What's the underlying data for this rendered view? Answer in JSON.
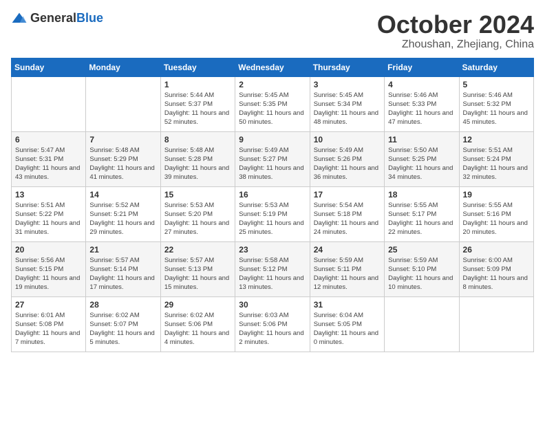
{
  "header": {
    "logo_general": "General",
    "logo_blue": "Blue",
    "month": "October 2024",
    "location": "Zhoushan, Zhejiang, China"
  },
  "weekdays": [
    "Sunday",
    "Monday",
    "Tuesday",
    "Wednesday",
    "Thursday",
    "Friday",
    "Saturday"
  ],
  "weeks": [
    [
      {
        "day": "",
        "info": ""
      },
      {
        "day": "",
        "info": ""
      },
      {
        "day": "1",
        "info": "Sunrise: 5:44 AM\nSunset: 5:37 PM\nDaylight: 11 hours and 52 minutes."
      },
      {
        "day": "2",
        "info": "Sunrise: 5:45 AM\nSunset: 5:35 PM\nDaylight: 11 hours and 50 minutes."
      },
      {
        "day": "3",
        "info": "Sunrise: 5:45 AM\nSunset: 5:34 PM\nDaylight: 11 hours and 48 minutes."
      },
      {
        "day": "4",
        "info": "Sunrise: 5:46 AM\nSunset: 5:33 PM\nDaylight: 11 hours and 47 minutes."
      },
      {
        "day": "5",
        "info": "Sunrise: 5:46 AM\nSunset: 5:32 PM\nDaylight: 11 hours and 45 minutes."
      }
    ],
    [
      {
        "day": "6",
        "info": "Sunrise: 5:47 AM\nSunset: 5:31 PM\nDaylight: 11 hours and 43 minutes."
      },
      {
        "day": "7",
        "info": "Sunrise: 5:48 AM\nSunset: 5:29 PM\nDaylight: 11 hours and 41 minutes."
      },
      {
        "day": "8",
        "info": "Sunrise: 5:48 AM\nSunset: 5:28 PM\nDaylight: 11 hours and 39 minutes."
      },
      {
        "day": "9",
        "info": "Sunrise: 5:49 AM\nSunset: 5:27 PM\nDaylight: 11 hours and 38 minutes."
      },
      {
        "day": "10",
        "info": "Sunrise: 5:49 AM\nSunset: 5:26 PM\nDaylight: 11 hours and 36 minutes."
      },
      {
        "day": "11",
        "info": "Sunrise: 5:50 AM\nSunset: 5:25 PM\nDaylight: 11 hours and 34 minutes."
      },
      {
        "day": "12",
        "info": "Sunrise: 5:51 AM\nSunset: 5:24 PM\nDaylight: 11 hours and 32 minutes."
      }
    ],
    [
      {
        "day": "13",
        "info": "Sunrise: 5:51 AM\nSunset: 5:22 PM\nDaylight: 11 hours and 31 minutes."
      },
      {
        "day": "14",
        "info": "Sunrise: 5:52 AM\nSunset: 5:21 PM\nDaylight: 11 hours and 29 minutes."
      },
      {
        "day": "15",
        "info": "Sunrise: 5:53 AM\nSunset: 5:20 PM\nDaylight: 11 hours and 27 minutes."
      },
      {
        "day": "16",
        "info": "Sunrise: 5:53 AM\nSunset: 5:19 PM\nDaylight: 11 hours and 25 minutes."
      },
      {
        "day": "17",
        "info": "Sunrise: 5:54 AM\nSunset: 5:18 PM\nDaylight: 11 hours and 24 minutes."
      },
      {
        "day": "18",
        "info": "Sunrise: 5:55 AM\nSunset: 5:17 PM\nDaylight: 11 hours and 22 minutes."
      },
      {
        "day": "19",
        "info": "Sunrise: 5:55 AM\nSunset: 5:16 PM\nDaylight: 11 hours and 20 minutes."
      }
    ],
    [
      {
        "day": "20",
        "info": "Sunrise: 5:56 AM\nSunset: 5:15 PM\nDaylight: 11 hours and 19 minutes."
      },
      {
        "day": "21",
        "info": "Sunrise: 5:57 AM\nSunset: 5:14 PM\nDaylight: 11 hours and 17 minutes."
      },
      {
        "day": "22",
        "info": "Sunrise: 5:57 AM\nSunset: 5:13 PM\nDaylight: 11 hours and 15 minutes."
      },
      {
        "day": "23",
        "info": "Sunrise: 5:58 AM\nSunset: 5:12 PM\nDaylight: 11 hours and 13 minutes."
      },
      {
        "day": "24",
        "info": "Sunrise: 5:59 AM\nSunset: 5:11 PM\nDaylight: 11 hours and 12 minutes."
      },
      {
        "day": "25",
        "info": "Sunrise: 5:59 AM\nSunset: 5:10 PM\nDaylight: 11 hours and 10 minutes."
      },
      {
        "day": "26",
        "info": "Sunrise: 6:00 AM\nSunset: 5:09 PM\nDaylight: 11 hours and 8 minutes."
      }
    ],
    [
      {
        "day": "27",
        "info": "Sunrise: 6:01 AM\nSunset: 5:08 PM\nDaylight: 11 hours and 7 minutes."
      },
      {
        "day": "28",
        "info": "Sunrise: 6:02 AM\nSunset: 5:07 PM\nDaylight: 11 hours and 5 minutes."
      },
      {
        "day": "29",
        "info": "Sunrise: 6:02 AM\nSunset: 5:06 PM\nDaylight: 11 hours and 4 minutes."
      },
      {
        "day": "30",
        "info": "Sunrise: 6:03 AM\nSunset: 5:06 PM\nDaylight: 11 hours and 2 minutes."
      },
      {
        "day": "31",
        "info": "Sunrise: 6:04 AM\nSunset: 5:05 PM\nDaylight: 11 hours and 0 minutes."
      },
      {
        "day": "",
        "info": ""
      },
      {
        "day": "",
        "info": ""
      }
    ]
  ]
}
